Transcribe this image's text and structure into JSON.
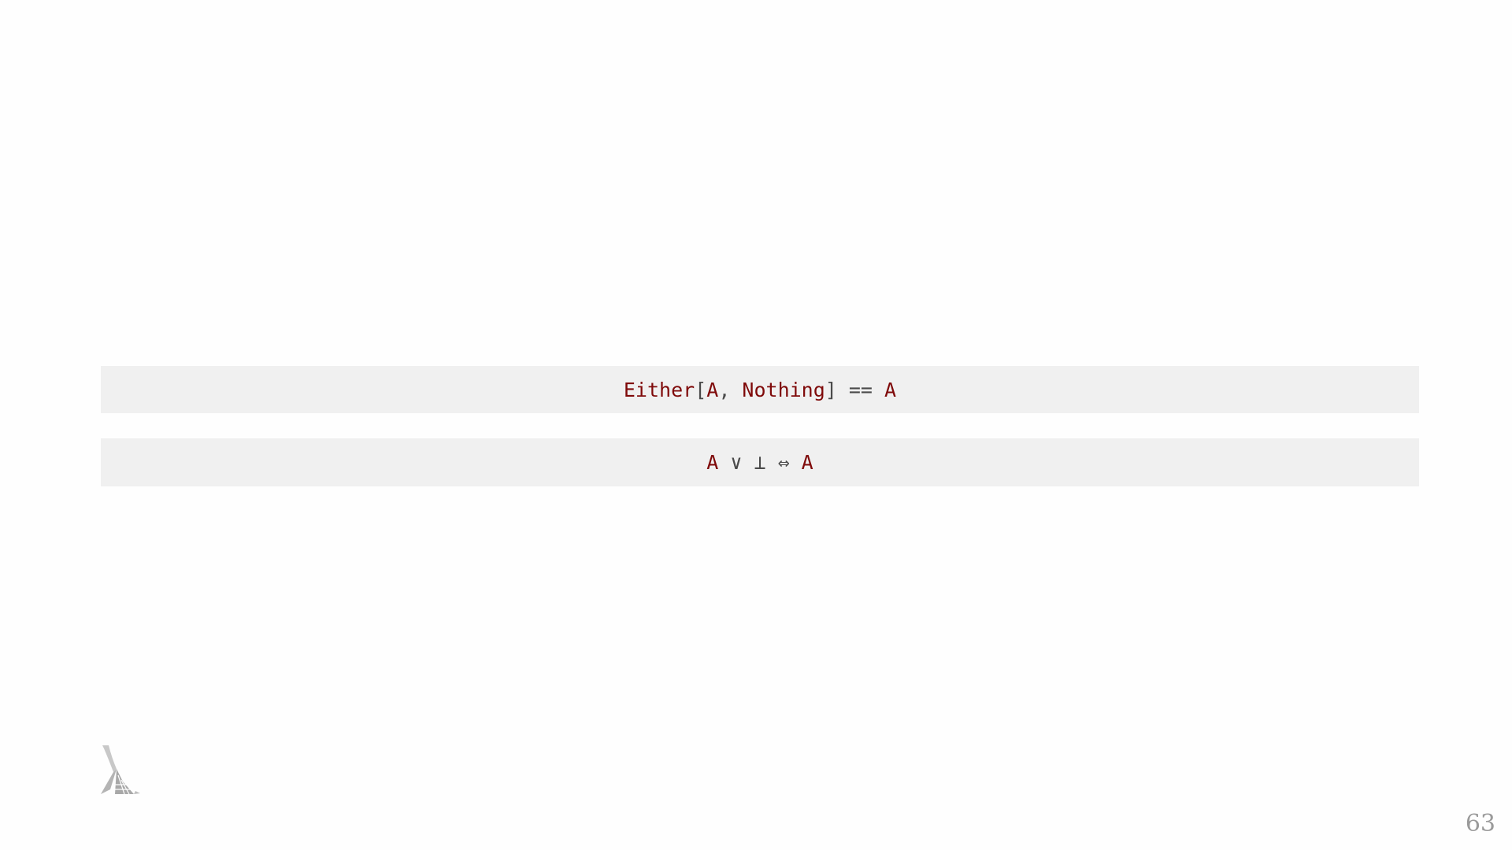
{
  "slide": {
    "code_line_1": {
      "tokens": [
        {
          "text": "Either",
          "kind": "type"
        },
        {
          "text": "[",
          "kind": "punct"
        },
        {
          "text": "A",
          "kind": "type"
        },
        {
          "text": ", ",
          "kind": "punct"
        },
        {
          "text": "Nothing",
          "kind": "type"
        },
        {
          "text": "] == ",
          "kind": "punct"
        },
        {
          "text": "A",
          "kind": "type"
        }
      ]
    },
    "code_line_2": {
      "tokens": [
        {
          "text": "A",
          "kind": "type"
        },
        {
          "text": " ∨ ⊥ ⇔ ",
          "kind": "punct"
        },
        {
          "text": "A",
          "kind": "type"
        }
      ]
    },
    "page_number": "63",
    "logo_icon": "lambda-logo-icon"
  },
  "colors": {
    "background": "#fefefe",
    "code_background": "#f0f0f0",
    "type_token": "#7f0a0a",
    "punct_token": "#4a4a4a",
    "page_number": "#9a9a9a",
    "logo": "#a8a8a8"
  }
}
